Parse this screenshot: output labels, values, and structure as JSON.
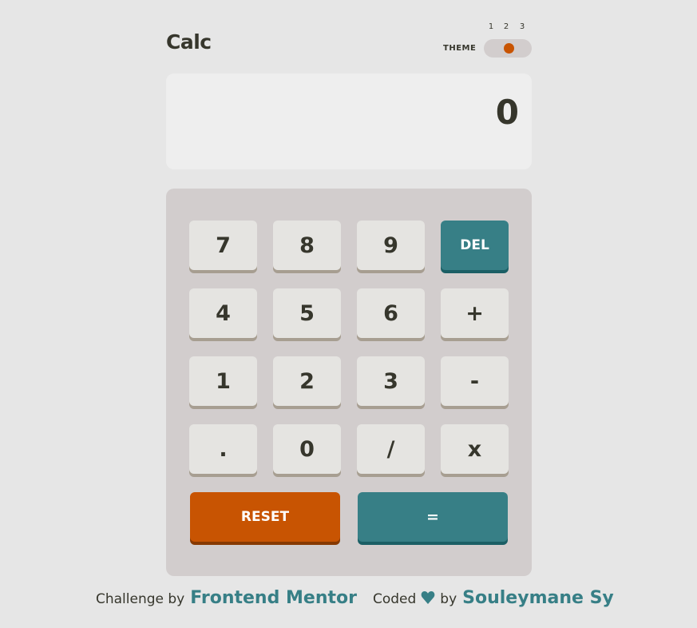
{
  "header": {
    "title": "Calc",
    "theme_label": "THEME",
    "theme_options": [
      "1",
      "2",
      "3"
    ],
    "theme_selected": "2"
  },
  "screen": {
    "value": "0"
  },
  "keypad": {
    "rows": [
      [
        "7",
        "8",
        "9",
        "DEL"
      ],
      [
        "4",
        "5",
        "6",
        "+"
      ],
      [
        "1",
        "2",
        "3",
        "-"
      ],
      [
        ".",
        "0",
        "/",
        "x"
      ]
    ],
    "reset_label": "RESET",
    "equals_label": "="
  },
  "footer": {
    "challenge_text": "Challenge by",
    "challenge_link": "Frontend Mentor",
    "coded_text": "Coded",
    "by_text": "by",
    "author_link": "Souleymane Sy"
  },
  "colors": {
    "background": "#e6e6e6",
    "keypad_bg": "#d2cdcd",
    "key_bg": "#e5e4e1",
    "accent_teal": "#377f86",
    "accent_orange": "#c85402",
    "text_dark": "#36362c"
  },
  "icons": {
    "footer_heart": "heart-icon"
  }
}
